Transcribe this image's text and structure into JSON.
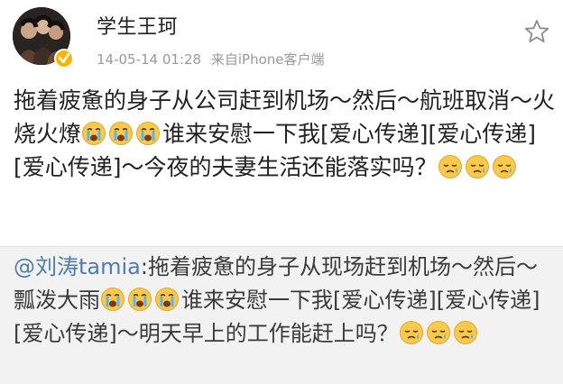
{
  "post": {
    "username": "学生王珂",
    "timestamp": "14-05-14 01:28",
    "source": "来自iPhone客户端",
    "text_part1": "拖着疲惫的身子从公司赶到机场～然后～航班取消～火烧火燎",
    "text_part2": "谁来安慰一下我[爱心传递][爱心传递][爱心传递]～今夜的夫妻生活还能落实吗？",
    "icons": {
      "avatar": "avatar-photo",
      "verified": "verified-badge-icon",
      "favorite": "star-icon",
      "crying": "crying-emoji",
      "sad": "sad-emoji"
    },
    "colors": {
      "mention": "#4f7cae",
      "verified": "#f7b500",
      "repost_bg": "#f2f2f2"
    }
  },
  "repost": {
    "mention": "@刘涛tamia",
    "text_part1": ":拖着疲惫的身子从现场赶到机场～然后～瓢泼大雨",
    "text_part2": "谁来安慰一下我[爱心传递][爱心传递][爱心传递]～明天早上的工作能赶上吗？"
  }
}
